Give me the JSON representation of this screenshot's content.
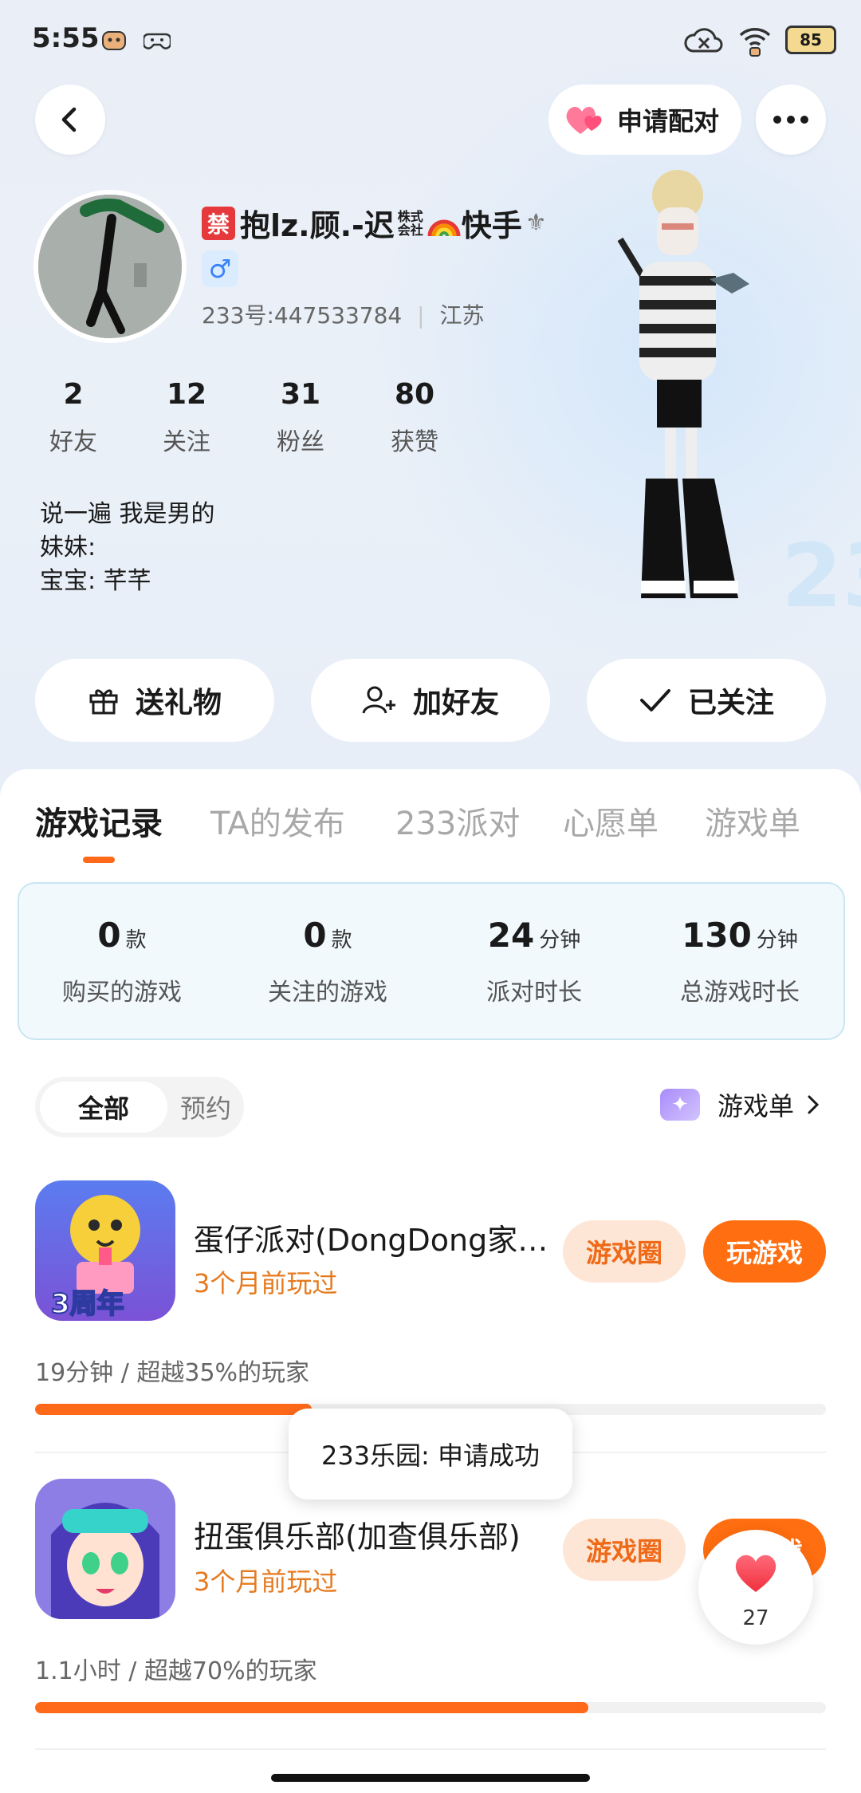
{
  "status_bar": {
    "time": "5:55",
    "battery": "85"
  },
  "header": {
    "pair_label": "申请配对"
  },
  "profile": {
    "ban_badge": "禁",
    "name": "抱lz.顾.-迟",
    "name_small": "株式会社",
    "name_suffix": "快手",
    "gender_symbol": "♂",
    "uid": "233号:447533784",
    "region": "江苏",
    "stats": [
      {
        "num": "2",
        "label": "好友"
      },
      {
        "num": "12",
        "label": "关注"
      },
      {
        "num": "31",
        "label": "粉丝"
      },
      {
        "num": "80",
        "label": "获赞"
      }
    ],
    "bio": [
      "说一遍 我是男的",
      "妹妹:",
      "宝宝: 芊芊"
    ]
  },
  "actions": {
    "gift": "送礼物",
    "add_friend": "加好友",
    "followed": "已关注"
  },
  "tabs": [
    "游戏记录",
    "TA的发布",
    "233派对",
    "心愿单",
    "游戏单"
  ],
  "summary": [
    {
      "value": "0",
      "unit": "款",
      "label": "购买的游戏"
    },
    {
      "value": "0",
      "unit": "款",
      "label": "关注的游戏"
    },
    {
      "value": "24",
      "unit": "分钟",
      "label": "派对时长"
    },
    {
      "value": "130",
      "unit": "分钟",
      "label": "总游戏时长"
    }
  ],
  "filter": {
    "all": "全部",
    "reserve": "预约",
    "game_list_link": "游戏单"
  },
  "games": [
    {
      "title": "蛋仔派对(DongDong家…",
      "played": "3个月前玩过",
      "circle": "游戏圈",
      "play": "玩游戏",
      "stat": "19分钟 / 超越35%的玩家",
      "progress": 0.35,
      "icon_text": "3周年"
    },
    {
      "title": "扭蛋俱乐部(加查俱乐部)",
      "played": "3个月前玩过",
      "circle": "游戏圈",
      "play": "玩游戏",
      "stat": "1.1小时 / 超越70%的玩家",
      "progress": 0.7,
      "icon_text": ""
    }
  ],
  "toast": "233乐园: 申请成功",
  "like": {
    "count": "27"
  },
  "colors": {
    "accent": "#ff6a1a",
    "played_text": "#e67a1e",
    "circle_bg": "#fde6d6"
  }
}
